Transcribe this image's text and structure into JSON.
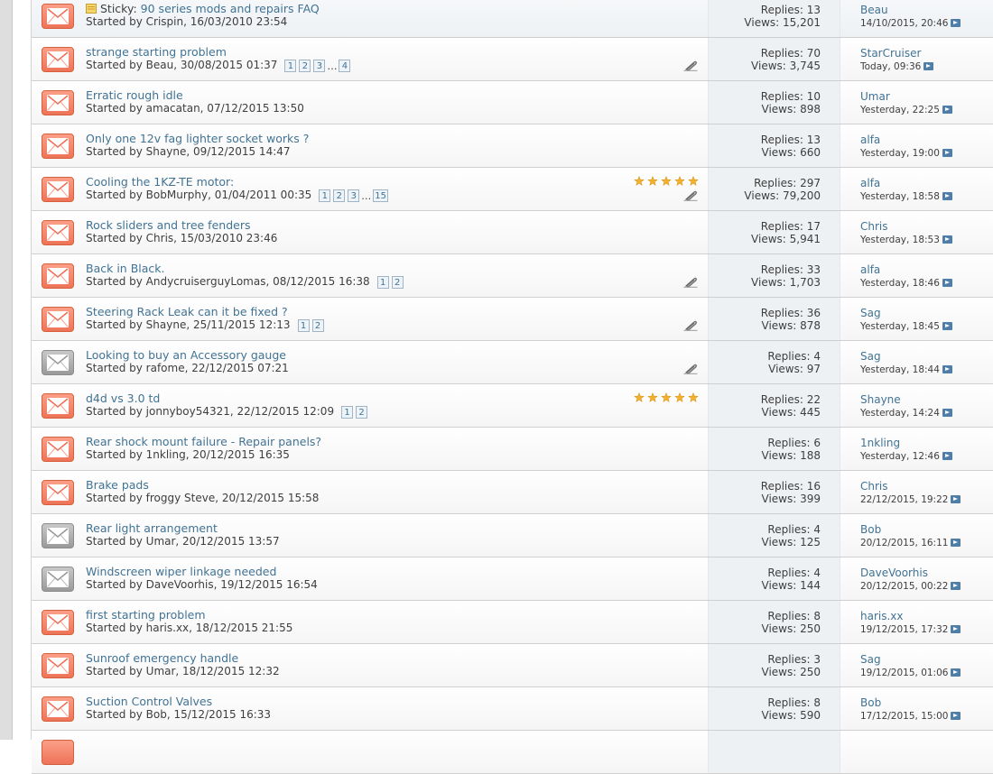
{
  "sticky_prefix": "Sticky:",
  "threads": [
    {
      "title": "90 series mods and repairs FAQ",
      "started": "Started by Crispin, 16/03/2010 23:54",
      "pages": [],
      "replies": "Replies: 13",
      "views": "Views: 15,201",
      "last_user": "Beau",
      "last_date": "14/10/2015, 20:46",
      "sticky": true,
      "read": false,
      "rating": 0,
      "attachment": false
    },
    {
      "title": "strange starting problem",
      "started": "Started by Beau, 30/08/2015 01:37",
      "pages": [
        "1",
        "2",
        "3",
        "…",
        "4"
      ],
      "replies": "Replies: 70",
      "views": "Views: 3,745",
      "last_user": "StarCruiser",
      "last_date": "Today, 09:36",
      "sticky": false,
      "read": false,
      "rating": 0,
      "attachment": true
    },
    {
      "title": "Erratic rough idle",
      "started": "Started by amacatan, 07/12/2015 13:50",
      "pages": [],
      "replies": "Replies: 10",
      "views": "Views: 898",
      "last_user": "Umar",
      "last_date": "Yesterday, 22:25",
      "sticky": false,
      "read": false,
      "rating": 0,
      "attachment": false
    },
    {
      "title": "Only one 12v fag lighter socket works ?",
      "started": "Started by Shayne, 09/12/2015 14:47",
      "pages": [],
      "replies": "Replies: 13",
      "views": "Views: 660",
      "last_user": "alfa",
      "last_date": "Yesterday, 19:00",
      "sticky": false,
      "read": false,
      "rating": 0,
      "attachment": false
    },
    {
      "title": "Cooling the 1KZ-TE motor:",
      "started": "Started by BobMurphy, 01/04/2011 00:35",
      "pages": [
        "1",
        "2",
        "3",
        "…",
        "15"
      ],
      "replies": "Replies: 297",
      "views": "Views: 79,200",
      "last_user": "alfa",
      "last_date": "Yesterday, 18:58",
      "sticky": false,
      "read": false,
      "rating": 5,
      "attachment": true
    },
    {
      "title": "Rock sliders and tree fenders",
      "started": "Started by Chris, 15/03/2010 23:46",
      "pages": [],
      "replies": "Replies: 17",
      "views": "Views: 5,941",
      "last_user": "Chris",
      "last_date": "Yesterday, 18:53",
      "sticky": false,
      "read": false,
      "rating": 0,
      "attachment": false
    },
    {
      "title": "Back in Black.",
      "started": "Started by AndycruiserguyLomas, 08/12/2015 16:38",
      "pages": [
        "1",
        "2"
      ],
      "replies": "Replies: 33",
      "views": "Views: 1,703",
      "last_user": "alfa",
      "last_date": "Yesterday, 18:46",
      "sticky": false,
      "read": false,
      "rating": 0,
      "attachment": true
    },
    {
      "title": "Steering Rack Leak can it be fixed ?",
      "started": "Started by Shayne, 25/11/2015 12:13",
      "pages": [
        "1",
        "2"
      ],
      "replies": "Replies: 36",
      "views": "Views: 878",
      "last_user": "Sag",
      "last_date": "Yesterday, 18:45",
      "sticky": false,
      "read": false,
      "rating": 0,
      "attachment": true
    },
    {
      "title": "Looking to buy an Accessory gauge",
      "started": "Started by rafome, 22/12/2015 07:21",
      "pages": [],
      "replies": "Replies: 4",
      "views": "Views: 97",
      "last_user": "Sag",
      "last_date": "Yesterday, 18:44",
      "sticky": false,
      "read": true,
      "rating": 0,
      "attachment": true
    },
    {
      "title": "d4d vs 3.0 td",
      "started": "Started by jonnyboy54321, 22/12/2015 12:09",
      "pages": [
        "1",
        "2"
      ],
      "replies": "Replies: 22",
      "views": "Views: 445",
      "last_user": "Shayne",
      "last_date": "Yesterday, 14:24",
      "sticky": false,
      "read": false,
      "rating": 5,
      "attachment": false
    },
    {
      "title": "Rear shock mount failure - Repair panels?",
      "started": "Started by 1nkling, 20/12/2015 16:35",
      "pages": [],
      "replies": "Replies: 6",
      "views": "Views: 188",
      "last_user": "1nkling",
      "last_date": "Yesterday, 12:46",
      "sticky": false,
      "read": false,
      "rating": 0,
      "attachment": false
    },
    {
      "title": "Brake pads",
      "started": "Started by froggy Steve, 20/12/2015 15:58",
      "pages": [],
      "replies": "Replies: 16",
      "views": "Views: 399",
      "last_user": "Chris",
      "last_date": "22/12/2015, 19:22",
      "sticky": false,
      "read": false,
      "rating": 0,
      "attachment": false
    },
    {
      "title": "Rear light arrangement",
      "started": "Started by Umar, 20/12/2015 13:57",
      "pages": [],
      "replies": "Replies: 4",
      "views": "Views: 125",
      "last_user": "Bob",
      "last_date": "20/12/2015, 16:11",
      "sticky": false,
      "read": true,
      "rating": 0,
      "attachment": false
    },
    {
      "title": "Windscreen wiper linkage needed",
      "started": "Started by DaveVoorhis, 19/12/2015 16:54",
      "pages": [],
      "replies": "Replies: 4",
      "views": "Views: 144",
      "last_user": "DaveVoorhis",
      "last_date": "20/12/2015, 00:22",
      "sticky": false,
      "read": true,
      "rating": 0,
      "attachment": false
    },
    {
      "title": "first starting problem",
      "started": "Started by haris.xx, 18/12/2015 21:55",
      "pages": [],
      "replies": "Replies: 8",
      "views": "Views: 250",
      "last_user": "haris.xx",
      "last_date": "19/12/2015, 17:32",
      "sticky": false,
      "read": false,
      "rating": 0,
      "attachment": false
    },
    {
      "title": "Sunroof emergency handle",
      "started": "Started by Umar, 18/12/2015 12:32",
      "pages": [],
      "replies": "Replies: 3",
      "views": "Views: 250",
      "last_user": "Sag",
      "last_date": "19/12/2015, 01:06",
      "sticky": false,
      "read": false,
      "rating": 0,
      "attachment": false
    },
    {
      "title": "Suction Control Valves",
      "started": "Started by Bob, 15/12/2015 16:33",
      "pages": [],
      "replies": "Replies: 8",
      "views": "Views: 590",
      "last_user": "Bob",
      "last_date": "17/12/2015, 15:00",
      "sticky": false,
      "read": false,
      "rating": 0,
      "attachment": false
    }
  ],
  "colors": {
    "link": "#417394",
    "unread_icon": "#ee7358",
    "read_icon": "#a8a8a8",
    "star": "#f3b12b"
  },
  "icons": {
    "thread_status": "envelope-icon",
    "attachment": "paperclip-icon",
    "rating": "star-icon",
    "last_post": "go-to-last-post-icon",
    "sticky": "sticky-flag-icon"
  }
}
